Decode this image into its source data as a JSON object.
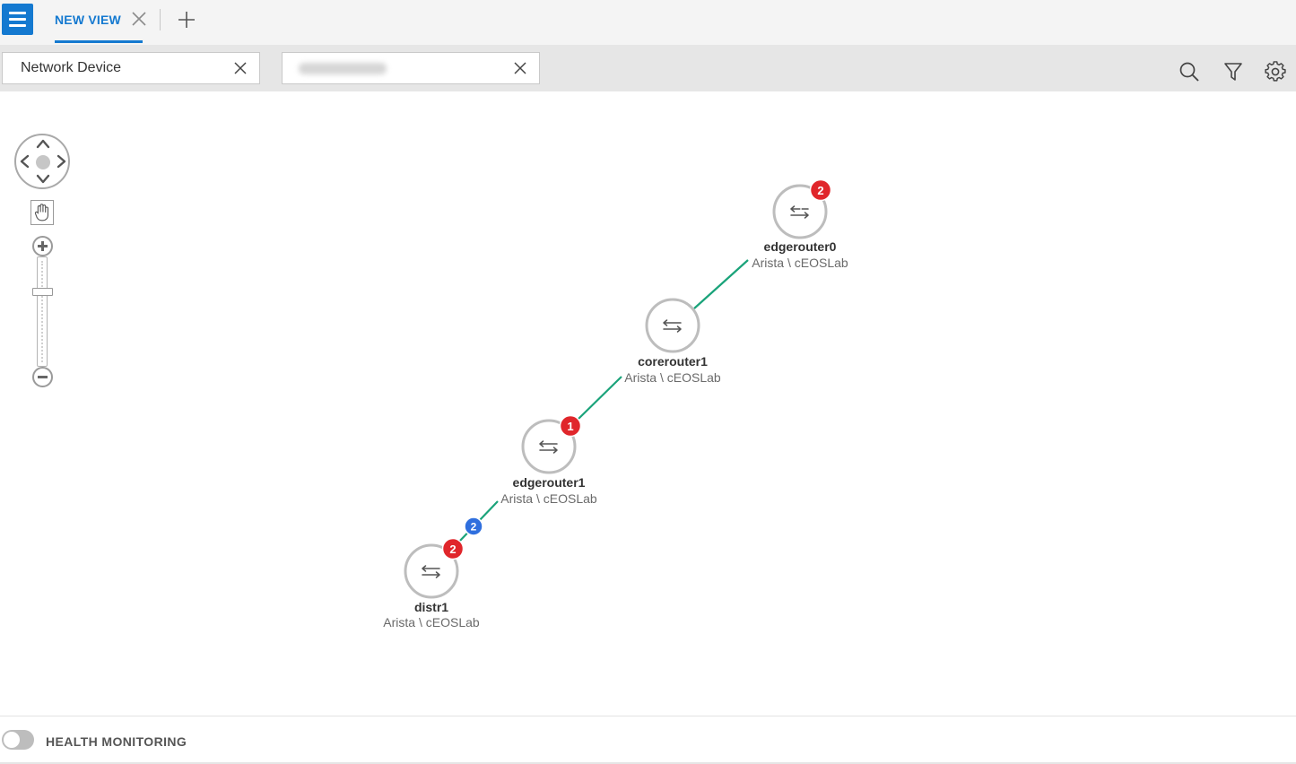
{
  "tabs": {
    "menu_icon": "hamburger-icon",
    "items": [
      {
        "label": "NEW VIEW",
        "active": true
      }
    ],
    "close_icon": "close-icon",
    "add_icon": "plus-icon"
  },
  "filters": {
    "chips": [
      {
        "value": "Network Device"
      },
      {
        "value": "",
        "redacted": true
      }
    ],
    "toolbar_icons": [
      "search-icon",
      "filter-icon",
      "gear-icon"
    ]
  },
  "navigation": {
    "pan_icon": "pan-arrows-icon",
    "hand_icon": "hand-icon",
    "zoom_in_icon": "zoom-in-icon",
    "zoom_out_icon": "zoom-out-icon"
  },
  "topology": {
    "device_icon": "router-arrows-icon",
    "nodes": [
      {
        "id": "edgerouter0",
        "name": "edgerouter0",
        "subtitle": "Arista \\ cEOSLab",
        "badge": "2",
        "badge_color": "#e0262b"
      },
      {
        "id": "corerouter1",
        "name": "corerouter1",
        "subtitle": "Arista \\ cEOSLab",
        "badge": "",
        "badge_color": ""
      },
      {
        "id": "edgerouter1",
        "name": "edgerouter1",
        "subtitle": "Arista \\ cEOSLab",
        "badge": "1",
        "badge_color": "#e0262b"
      },
      {
        "id": "distr1",
        "name": "distr1",
        "subtitle": "Arista \\ cEOSLab",
        "badge": "2",
        "badge_color": "#e0262b"
      }
    ],
    "links": [
      {
        "from": "edgerouter0",
        "to": "corerouter1",
        "badge": ""
      },
      {
        "from": "corerouter1",
        "to": "edgerouter1",
        "badge": ""
      },
      {
        "from": "edgerouter1",
        "to": "distr1",
        "badge": "2",
        "badge_color": "#2f6fde"
      }
    ],
    "link_color": "#1aa37a"
  },
  "footer": {
    "toggle_on": false,
    "label": "HEALTH MONITORING"
  },
  "colors": {
    "accent": "#1479d0",
    "alert": "#e0262b",
    "link_badge": "#2f6fde"
  }
}
